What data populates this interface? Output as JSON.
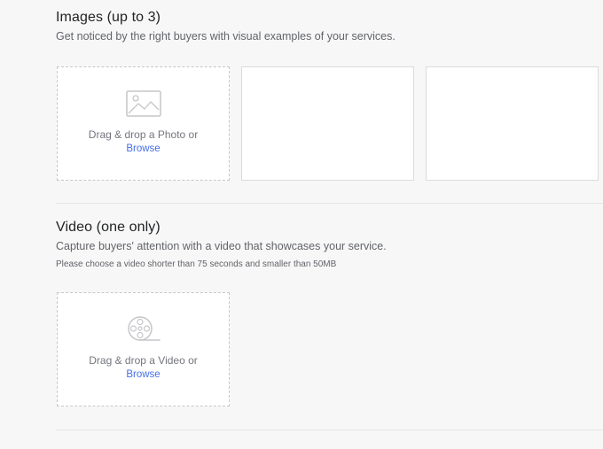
{
  "images": {
    "title": "Images (up to 3)",
    "description": "Get noticed by the right buyers with visual examples of your services.",
    "dropzone": {
      "icon": "image-placeholder-icon",
      "prompt": "Drag & drop a Photo or",
      "browse": "Browse"
    }
  },
  "video": {
    "title": "Video (one only)",
    "description": "Capture buyers' attention with a video that showcases your service.",
    "note": "Please choose a video shorter than 75 seconds and smaller than 50MB",
    "dropzone": {
      "icon": "film-reel-icon",
      "prompt": "Drag & drop a Video or",
      "browse": "Browse"
    }
  },
  "colors": {
    "link": "#446ee7",
    "background": "#f7f7f7",
    "tile": "#ffffff"
  }
}
